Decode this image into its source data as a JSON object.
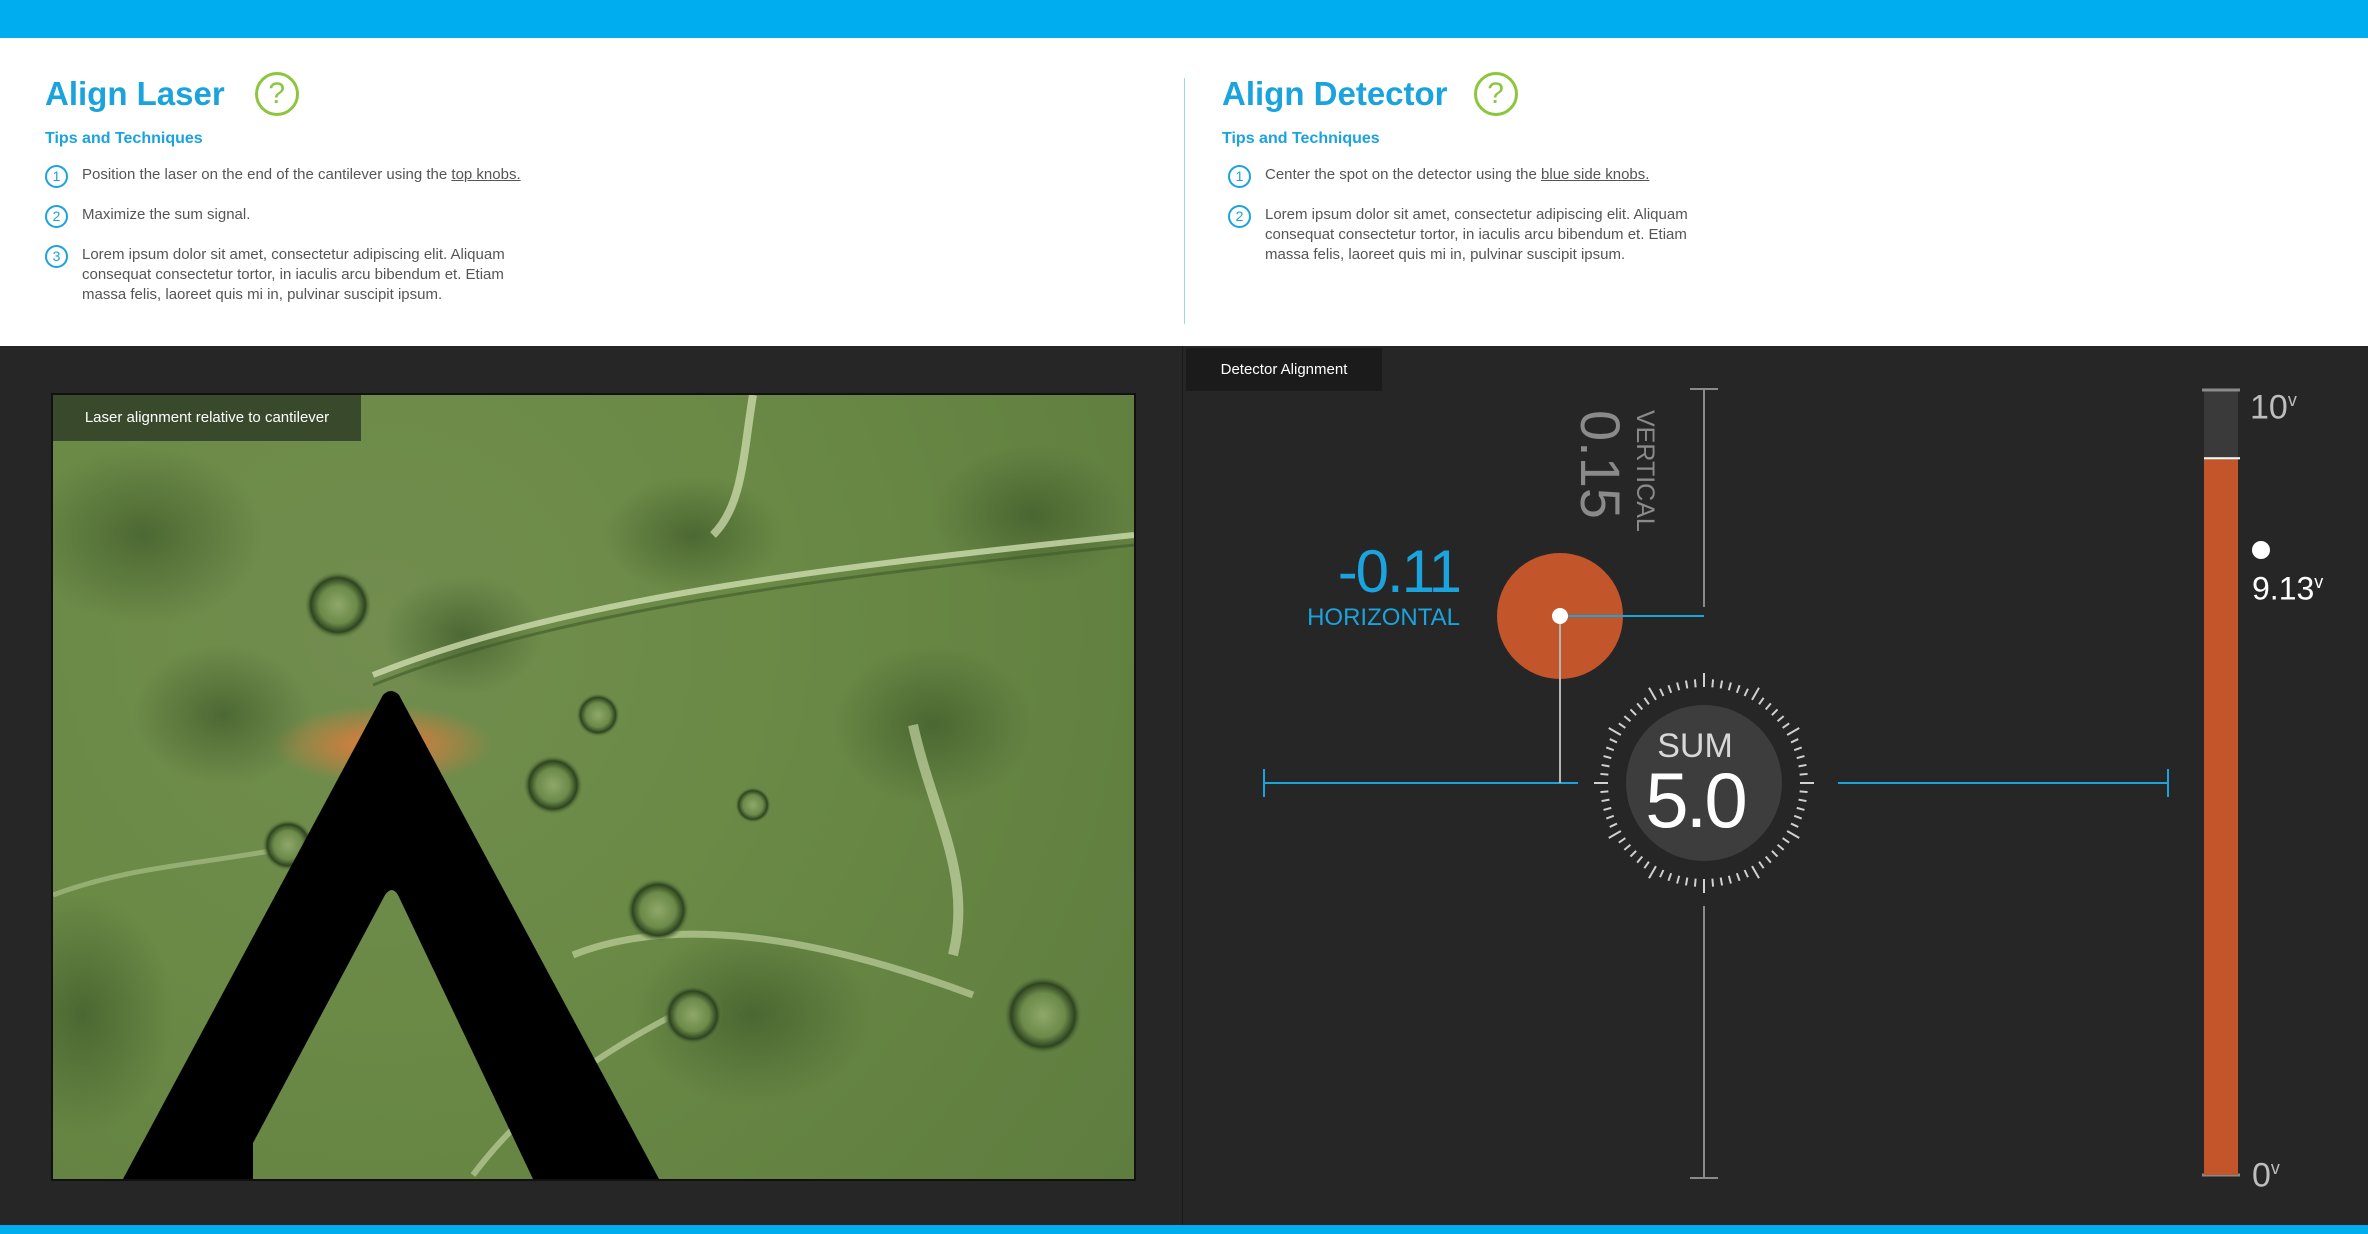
{
  "align_laser": {
    "title": "Align Laser",
    "help_symbol": "?",
    "tips_heading": "Tips and Techniques",
    "steps": [
      {
        "num": "1",
        "text_before": "Position the laser on the end of the cantilever using the ",
        "link": "top knobs.",
        "text_after": ""
      },
      {
        "num": "2",
        "text_before": "Maximize the sum signal.",
        "link": "",
        "text_after": ""
      },
      {
        "num": "3",
        "text_before": "Lorem ipsum dolor sit amet, consectetur adipiscing elit. Aliquam consequat consectetur tortor, in iaculis arcu bibendum et. Etiam massa felis, laoreet quis mi in, pulvinar suscipit ipsum.",
        "link": "",
        "text_after": ""
      }
    ]
  },
  "align_detector": {
    "title": "Align Detector",
    "help_symbol": "?",
    "tips_heading": "Tips and Techniques",
    "steps": [
      {
        "num": "1",
        "text_before": "Center the spot on the detector using the ",
        "link": "blue side knobs.",
        "text_after": ""
      },
      {
        "num": "2",
        "text_before": "Lorem ipsum dolor sit amet, consectetur adipiscing elit. Aliquam consequat consectetur tortor, in iaculis arcu bibendum et. Etiam massa felis, laoreet quis mi in, pulvinar suscipit ipsum.",
        "link": "",
        "text_after": ""
      }
    ]
  },
  "laser_view": {
    "caption": "Laser alignment relative to cantilever"
  },
  "detector": {
    "caption": "Detector Alignment",
    "horizontal_value": "-0.11",
    "horizontal_label": "HORIZONTAL",
    "vertical_value": "0.15",
    "vertical_label": "VERTICAL",
    "sum_label": "SUM",
    "sum_value": "5.0"
  },
  "voltage": {
    "max_label": "10",
    "min_label": "0",
    "current_label": "9.13",
    "unit": "v",
    "level_fraction": 0.913
  },
  "colors": {
    "accent_blue": "#00aeef",
    "help_green": "#8cc63f",
    "spot_orange": "#c2562a",
    "stage_dark": "#262626"
  }
}
